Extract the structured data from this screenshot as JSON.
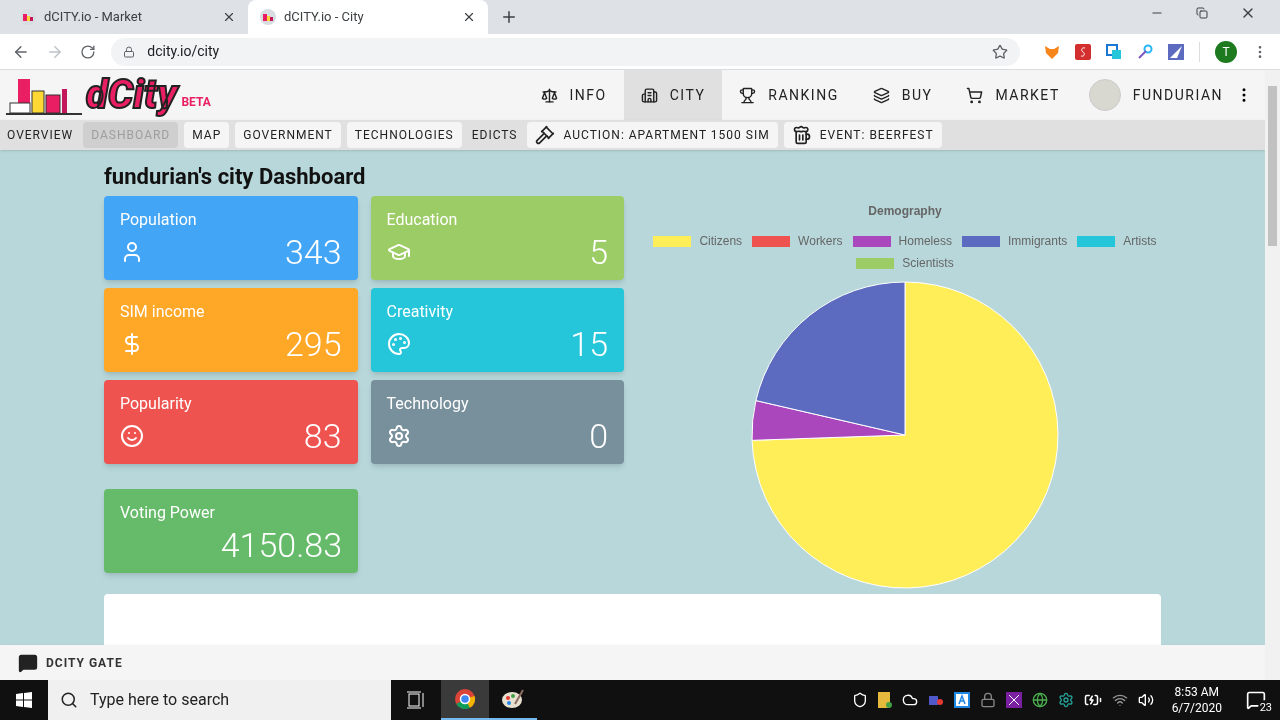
{
  "browser": {
    "tabs": [
      {
        "title": "dCITY.io - Market",
        "selected": false
      },
      {
        "title": "dCITY.io - City",
        "selected": true
      }
    ],
    "url": "dcity.io/city",
    "profile_initial": "T"
  },
  "site": {
    "logo": {
      "text": "dCity",
      "badge": "BETA"
    },
    "nav": [
      {
        "label": "INFO",
        "selected": false
      },
      {
        "label": "CITY",
        "selected": true
      },
      {
        "label": "RANKING",
        "selected": false
      },
      {
        "label": "BUY",
        "selected": false
      },
      {
        "label": "MARKET",
        "selected": false
      }
    ],
    "user": "FUNDURIAN",
    "subnav": [
      {
        "label": "OVERVIEW",
        "selected": false,
        "kind": "plain"
      },
      {
        "label": "DASHBOARD",
        "selected": true,
        "kind": "chip"
      },
      {
        "label": "MAP",
        "selected": false,
        "kind": "chip"
      },
      {
        "label": "GOVERNMENT",
        "selected": false,
        "kind": "chip"
      },
      {
        "label": "TECHNOLOGIES",
        "selected": false,
        "kind": "chip"
      },
      {
        "label": "EDICTS",
        "selected": false,
        "kind": "plain"
      },
      {
        "label": "AUCTION: APARTMENT 1500 SIM",
        "selected": false,
        "kind": "chip"
      },
      {
        "label": "EVENT: BEERFEST",
        "selected": false,
        "kind": "chip"
      }
    ]
  },
  "dashboard": {
    "title": "fundurian's city Dashboard",
    "cards": [
      {
        "label": "Population",
        "value": "343",
        "color": "#42a5f5"
      },
      {
        "label": "Education",
        "value": "5",
        "color": "#9ccc65"
      },
      {
        "label": "SIM income",
        "value": "295",
        "color": "#ffa726"
      },
      {
        "label": "Creativity",
        "value": "15",
        "color": "#26c6da"
      },
      {
        "label": "Popularity",
        "value": "83",
        "color": "#ef5350"
      },
      {
        "label": "Technology",
        "value": "0",
        "color": "#78909c"
      }
    ],
    "voting": {
      "label": "Voting Power",
      "value": "4150.83",
      "color": "#66bb6a"
    },
    "chart": {
      "title": "Demography",
      "legend": [
        {
          "label": "Citizens",
          "color": "#ffee58"
        },
        {
          "label": "Workers",
          "color": "#ef5350"
        },
        {
          "label": "Homeless",
          "color": "#ab47bc"
        },
        {
          "label": "Immigrants",
          "color": "#5c6bc0"
        },
        {
          "label": "Artists",
          "color": "#26c6da"
        },
        {
          "label": "Scientists",
          "color": "#9ccc65"
        }
      ]
    }
  },
  "chat_bar": {
    "label": "DCITY GATE"
  },
  "taskbar": {
    "search_placeholder": "Type here to search",
    "time": "8:53 AM",
    "date": "6/7/2020",
    "notifications": "23"
  }
}
